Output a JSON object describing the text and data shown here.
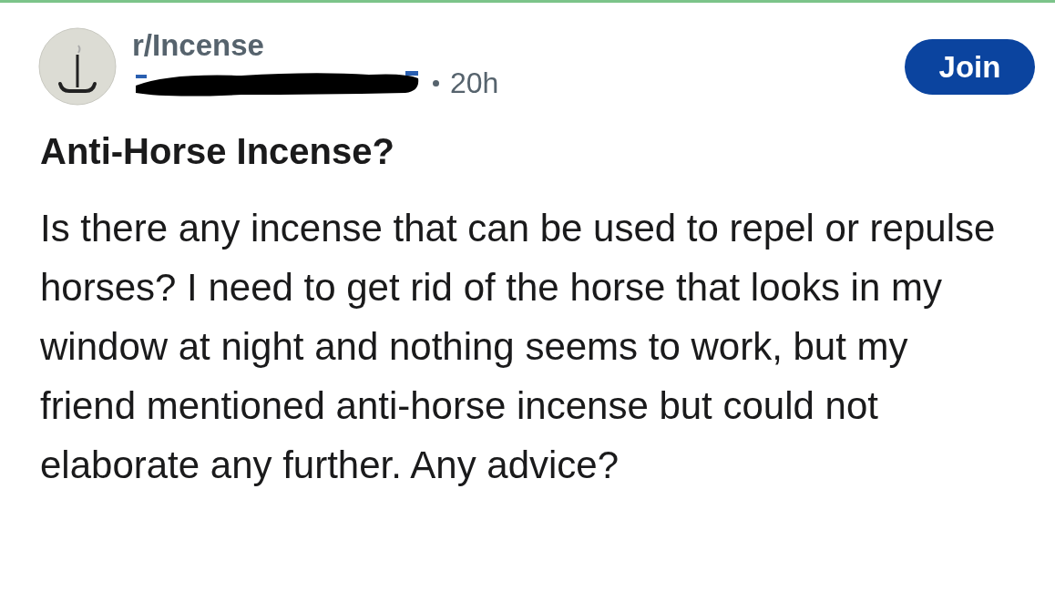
{
  "post": {
    "subreddit": "r/Incense",
    "author_redacted": true,
    "time": "20h",
    "join_button": "Join",
    "title": "Anti-Horse Incense?",
    "body": "Is there any incense that can be used to repel or repulse horses? I need to get rid of the horse that looks in my window at night and nothing seems to work, but my friend mentioned anti-horse incense but could not elaborate any further. Any advice?"
  }
}
